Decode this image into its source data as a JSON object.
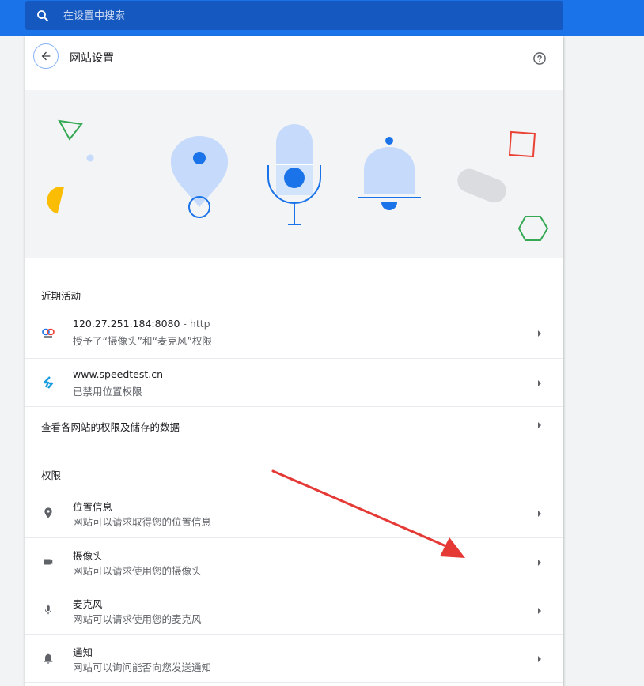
{
  "search": {
    "placeholder": "在设置中搜索"
  },
  "header": {
    "title": "网站设置"
  },
  "recent": {
    "label": "近期活动",
    "items": [
      {
        "host": "120.27.251.184:8080",
        "separator": "-",
        "scheme": "http",
        "detail": "授予了“摄像头”和“麦克风”权限"
      },
      {
        "host": "www.speedtest.cn",
        "detail": "已禁用位置权限"
      }
    ],
    "all_sites_link": "查看各网站的权限及储存的数据"
  },
  "permissions": {
    "label": "权限",
    "items": [
      {
        "icon": "location-pin-icon",
        "title": "位置信息",
        "desc": "网站可以请求取得您的位置信息"
      },
      {
        "icon": "camera-icon",
        "title": "摄像头",
        "desc": "网站可以请求使用您的摄像头"
      },
      {
        "icon": "microphone-icon",
        "title": "麦克风",
        "desc": "网站可以请求使用您的麦克风"
      },
      {
        "icon": "bell-icon",
        "title": "通知",
        "desc": "网站可以询问能否向您发送通知"
      }
    ]
  },
  "colors": {
    "accent": "#1a73e8",
    "annotation_arrow": "#e53935"
  }
}
